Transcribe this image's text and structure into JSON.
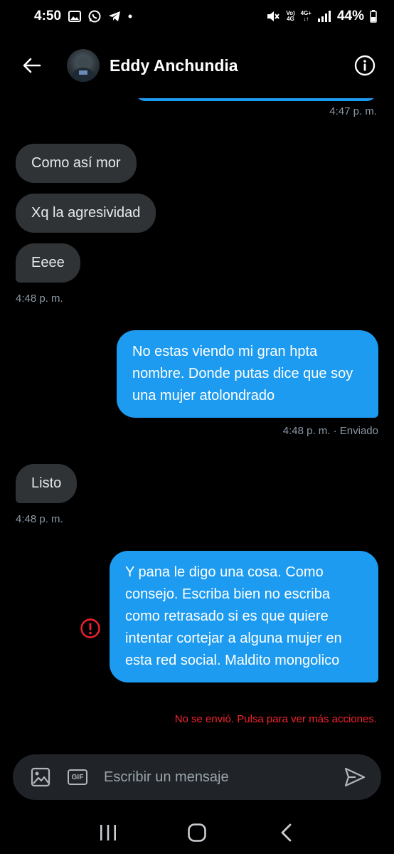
{
  "status_bar": {
    "time": "4:50",
    "network_top": "Vo)",
    "network_bottom": "4G",
    "network_type": "4G+",
    "battery": "44%"
  },
  "header": {
    "contact_name": "Eddy Anchundia"
  },
  "messages": [
    {
      "id": "t1",
      "type": "timestamp",
      "text": "4:47 p. m."
    },
    {
      "id": "m1",
      "direction": "in",
      "text": "Como así mor"
    },
    {
      "id": "m2",
      "direction": "in",
      "text": "Xq la agresividad"
    },
    {
      "id": "m3",
      "direction": "in",
      "text": "Eeee"
    },
    {
      "id": "t2",
      "type": "timestamp",
      "text": "4:48 p. m."
    },
    {
      "id": "m4",
      "direction": "out",
      "text": "No estas viendo mi gran hpta nombre. Donde putas dice que soy una mujer atolondrado"
    },
    {
      "id": "t3",
      "type": "timestamp",
      "text": "4:48 p. m. · Enviado"
    },
    {
      "id": "m5",
      "direction": "in",
      "text": "Listo"
    },
    {
      "id": "t4",
      "type": "timestamp",
      "text": "4:48 p. m."
    },
    {
      "id": "m6",
      "direction": "out",
      "status": "failed",
      "text": "Y pana le digo una cosa. Como consejo.  Escriba bien no escriba como retrasado si es que quiere intentar cortejar a alguna mujer en esta red social. Maldito mongolico"
    }
  ],
  "error_notice": "No se envió. Pulsa para ver más acciones.",
  "composer": {
    "placeholder": "Escribir un mensaje",
    "gif_label": "GIF"
  },
  "colors": {
    "accent": "#1d9bf0",
    "incoming_bubble": "#2f3336",
    "error": "#f4212e",
    "background": "#000000"
  },
  "icons": [
    "back-arrow-icon",
    "info-icon",
    "image-icon",
    "gif-icon",
    "send-icon",
    "error-icon",
    "recents-icon",
    "home-icon",
    "nav-back-icon"
  ]
}
